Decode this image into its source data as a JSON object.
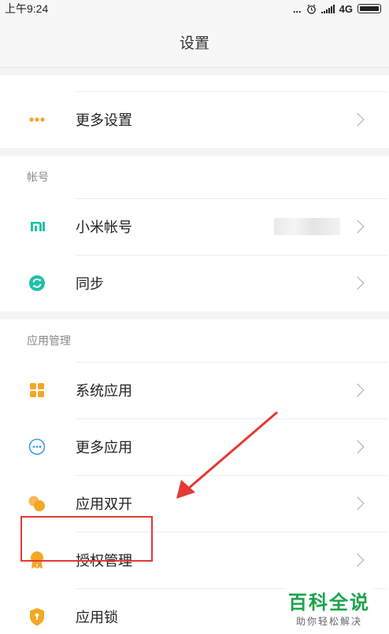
{
  "status_bar": {
    "time": "上午9:24",
    "dots": "...",
    "network": "4G"
  },
  "header": {
    "title": "设置"
  },
  "groups": {
    "more": {
      "items": [
        {
          "label": "更多设置",
          "icon": "more-dots-icon"
        }
      ]
    },
    "account": {
      "label": "帐号",
      "items": [
        {
          "label": "小米帐号",
          "icon": "mi-logo-icon"
        },
        {
          "label": "同步",
          "icon": "sync-icon"
        }
      ]
    },
    "apps": {
      "label": "应用管理",
      "items": [
        {
          "label": "系统应用",
          "icon": "grid-apps-icon"
        },
        {
          "label": "更多应用",
          "icon": "more-circle-icon"
        },
        {
          "label": "应用双开",
          "icon": "dual-app-icon"
        },
        {
          "label": "授权管理",
          "icon": "badge-icon"
        },
        {
          "label": "应用锁",
          "icon": "shield-lock-icon"
        }
      ]
    }
  },
  "colors": {
    "accent_orange": "#f5a623",
    "accent_teal": "#1fbfa8",
    "annotation_red": "#e53935",
    "watermark_green": "#1aa34a"
  },
  "watermark": {
    "title": "百科全说",
    "subtitle": "助你轻松解决"
  }
}
